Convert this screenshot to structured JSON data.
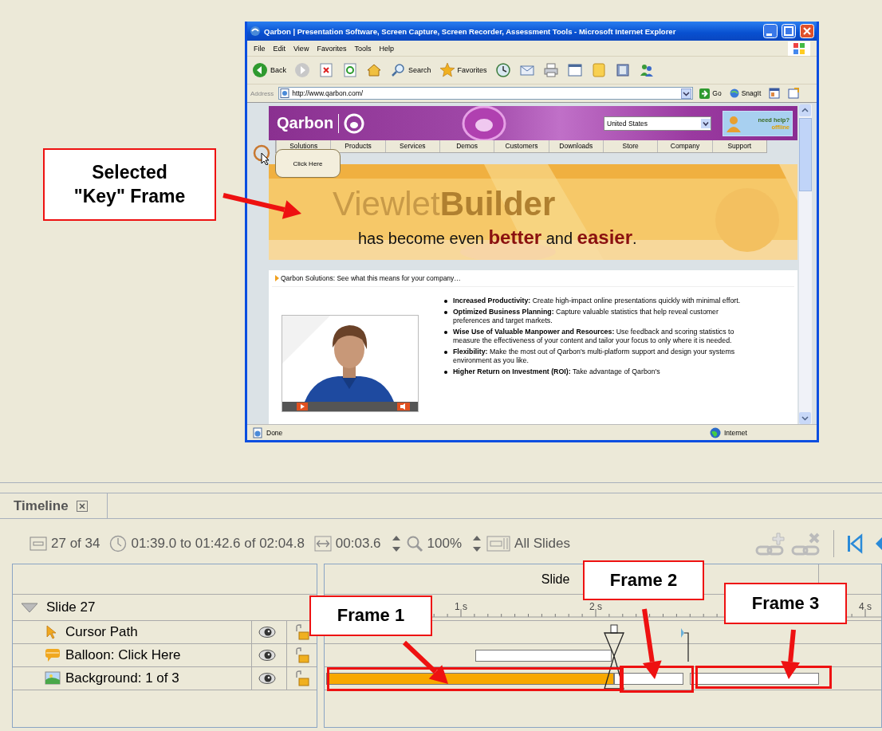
{
  "browser": {
    "title": "Qarbon | Presentation Software, Screen Capture, Screen Recorder, Assessment Tools - Microsoft Internet Explorer",
    "menu": [
      "File",
      "Edit",
      "View",
      "Favorites",
      "Tools",
      "Help"
    ],
    "toolbar": [
      {
        "kind": "back",
        "label": "Back"
      },
      {
        "kind": "forward"
      },
      {
        "kind": "stop"
      },
      {
        "kind": "refresh"
      },
      {
        "kind": "home"
      },
      {
        "kind": "search",
        "label": "Search"
      },
      {
        "kind": "favorites",
        "label": "Favorites"
      },
      {
        "kind": "history"
      },
      {
        "kind": "mail"
      },
      {
        "kind": "print"
      },
      {
        "kind": "edit"
      },
      {
        "kind": "notes"
      },
      {
        "kind": "research"
      },
      {
        "kind": "messenger"
      }
    ],
    "address": {
      "label": "Address",
      "value": "http://www.qarbon.com/"
    },
    "go": "Go",
    "links": [
      "SnagIt"
    ],
    "page": {
      "logo": "Qarbon",
      "country": "United States",
      "help": {
        "title": "need help?",
        "status": "offline"
      },
      "nav": [
        "Solutions",
        "Products",
        "Services",
        "Demos",
        "Customers",
        "Downloads",
        "Store",
        "Company",
        "Support"
      ],
      "banner": {
        "watermark": "Viewlet**Builder**",
        "headline": "has become even **better** and **easier**."
      },
      "section_title": "Qarbon Solutions: See what this means for your company…",
      "bullets": [
        "**Increased Productivity:** Create high-impact online presentations quickly with minimal effort.",
        "**Optimized Business Planning:** Capture valuable statistics that help reveal customer preferences and target markets.",
        "**Wise Use of Valuable Manpower and Resources:** Use feedback and scoring statistics to measure the effectiveness of your content and tailor your focus to only where it is needed.",
        "**Flexibility:** Make the most out of Qarbon's multi-platform support and design your systems environment as you like.",
        "**Higher Return on Investment (ROI):** Take advantage of Qarbon's"
      ]
    },
    "balloon": "Click Here",
    "status": {
      "text": "Done",
      "zone": "Internet"
    }
  },
  "timeline": {
    "tab": "Timeline",
    "toolbar": {
      "slide_position": "27 of 34",
      "time_range": "01:39.0 to 01:42.6 of 02:04.8",
      "duration": "00:03.6",
      "zoom": "100%",
      "scope": "All Slides"
    },
    "header": "Slide",
    "ruler": [
      "1 s",
      "2 s",
      "4 s"
    ],
    "layers": [
      {
        "label": "Slide 27",
        "expanded": true,
        "children": [
          {
            "kind": "cursor",
            "label": "Cursor Path",
            "visible": true,
            "locked": false
          },
          {
            "kind": "balloon",
            "label": "Balloon: Click Here",
            "visible": true,
            "locked": false
          },
          {
            "kind": "background",
            "label": "Background: 1 of 3",
            "visible": true,
            "locked": false,
            "frames": [
              {
                "selected": true
              },
              {
                "selected": false
              },
              {
                "selected": false
              }
            ]
          }
        ]
      }
    ]
  },
  "annotations": [
    {
      "text": "Selected \"Key\" Frame"
    },
    {
      "text": "Frame 1"
    },
    {
      "text": "Frame 2"
    },
    {
      "text": "Frame 3"
    }
  ]
}
